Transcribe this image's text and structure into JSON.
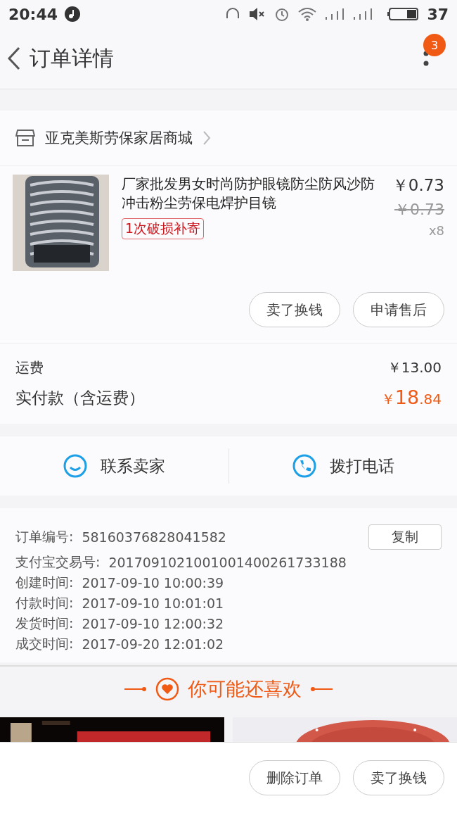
{
  "status_bar": {
    "time": "20:44",
    "battery": "37"
  },
  "header": {
    "title": "订单详情",
    "badge": "3"
  },
  "store": {
    "name": "亚克美斯劳保家居商城"
  },
  "product": {
    "title": "厂家批发男女时尚防护眼镜防尘防风沙防冲击粉尘劳保电焊护目镜",
    "tag": "1次破损补寄",
    "price": "￥0.73",
    "original_price": "￥0.73",
    "quantity": "x8",
    "buttons": [
      "卖了换钱",
      "申请售后"
    ]
  },
  "fees": [
    {
      "label": "运费",
      "value": "￥13.00",
      "kind": "plain"
    },
    {
      "label": "实付款（含运费）",
      "currency": "￥",
      "integer": "18",
      "decimal": ".84",
      "kind": "total"
    }
  ],
  "contact": [
    {
      "label": "联系卖家",
      "kind": "chat"
    },
    {
      "label": "拨打电话",
      "kind": "phone"
    }
  ],
  "order_info": [
    {
      "label": "订单编号:",
      "value": "58160376828041582",
      "action": "复制"
    },
    {
      "label": "支付宝交易号:",
      "value": "2017091021001001400261733188"
    },
    {
      "label": "创建时间:",
      "value": "2017-09-10 10:00:39"
    },
    {
      "label": "付款时间:",
      "value": "2017-09-10 10:01:01"
    },
    {
      "label": "发货时间:",
      "value": "2017-09-10 12:00:32"
    },
    {
      "label": "成交时间:",
      "value": "2017-09-20 12:01:02"
    }
  ],
  "recommend": {
    "title": "你可能还喜欢"
  },
  "bottom_buttons": [
    "删除订单",
    "卖了换钱"
  ]
}
